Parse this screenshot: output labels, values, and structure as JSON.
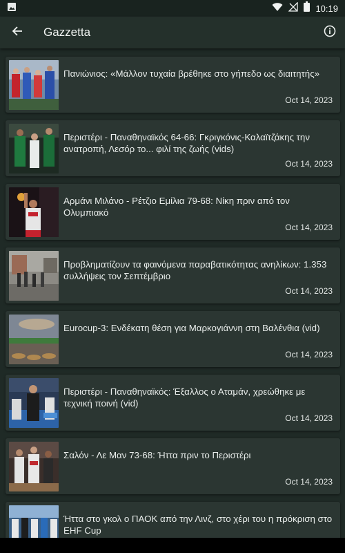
{
  "status_bar": {
    "time": "10:19",
    "icons": [
      "image-icon",
      "wifi-icon",
      "signal-off-icon",
      "battery-icon"
    ]
  },
  "app_bar": {
    "title": "Gazzetta",
    "back_icon": "arrow-back-icon",
    "info_icon": "info-icon"
  },
  "articles": [
    {
      "title": "Πανιώνιος: «Μάλλον τυχαία βρέθηκε στο γήπεδο ως διαιτητής»",
      "date": "Oct 14, 2023"
    },
    {
      "title": "Περιστέρι - Παναθηναϊκός 64-66: Γκριγκόνις-Καλαϊτζάκης την ανατροπή, Λεσόρ το... φιλί της ζωής (vids)",
      "date": "Oct 14, 2023"
    },
    {
      "title": "Αρμάνι Μιλάνο - Ρέτζιο Εμίλια 79-68: Νίκη πριν από τον Ολυμπιακό",
      "date": "Oct 14, 2023"
    },
    {
      "title": "Προβληματίζουν τα φαινόμενα παραβατικότητας ανηλίκων: 1.353 συλλήψεις τον Σεπτέμβριο",
      "date": "Oct 14, 2023"
    },
    {
      "title": "Eurocup-3: Ενδέκατη θέση για Μαρκογιάννη στη Βαλένθια (vid)",
      "date": "Oct 14, 2023"
    },
    {
      "title": "Περιστέρι - Παναθηναϊκός: Έξαλλος ο Αταμάν, χρεώθηκε με τεχνική ποινή (vid)",
      "date": "Oct 14, 2023"
    },
    {
      "title": "Σαλόν - Λε Μαν 73-68: Ήττα πριν το Περιστέρι",
      "date": "Oct 14, 2023"
    },
    {
      "title": "Ήττα στο γκολ ο ΠΑΟΚ από την Λινζ, στο χέρι του η πρόκριση στο EHF Cup",
      "date": ""
    }
  ],
  "colors": {
    "background": "#1f2a26",
    "card": "#2b3632",
    "app_bar": "#24302b",
    "text": "#e9edeb"
  }
}
